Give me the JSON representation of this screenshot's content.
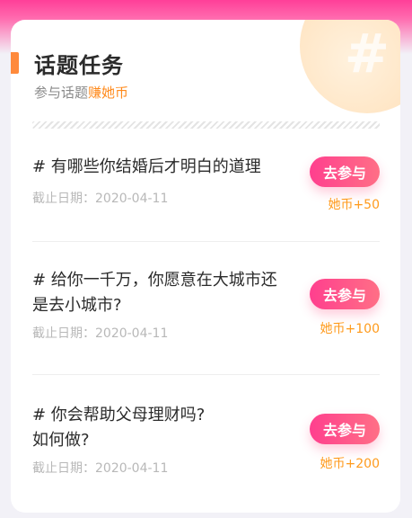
{
  "header": {
    "title": "话题任务",
    "subtitle_prefix": "参与话题",
    "subtitle_highlight": "赚她币"
  },
  "tasks": [
    {
      "title": "# 有哪些你结婚后才明白的道理",
      "deadline": "截止日期：2020-04-11",
      "button": "去参与",
      "reward": "她币+50"
    },
    {
      "title": "# 给你一千万，你愿意在大城市还是去小城市?",
      "deadline": "截止日期：2020-04-11",
      "button": "去参与",
      "reward": "她币+100"
    },
    {
      "title": "# 你会帮助父母理财吗?如何做?",
      "deadline": "截止日期：2020-04-11",
      "button": "去参与",
      "reward": "她币+200"
    }
  ],
  "decoration": {
    "icon": "hash-icon",
    "glyph": "#"
  },
  "colors": {
    "accent_orange": "#ff8a3c",
    "button_gradient_start": "#ff3f8e",
    "button_gradient_end": "#ff6f86",
    "reward_color": "#ff9a1c",
    "deadline_color": "#b8b8b8"
  }
}
